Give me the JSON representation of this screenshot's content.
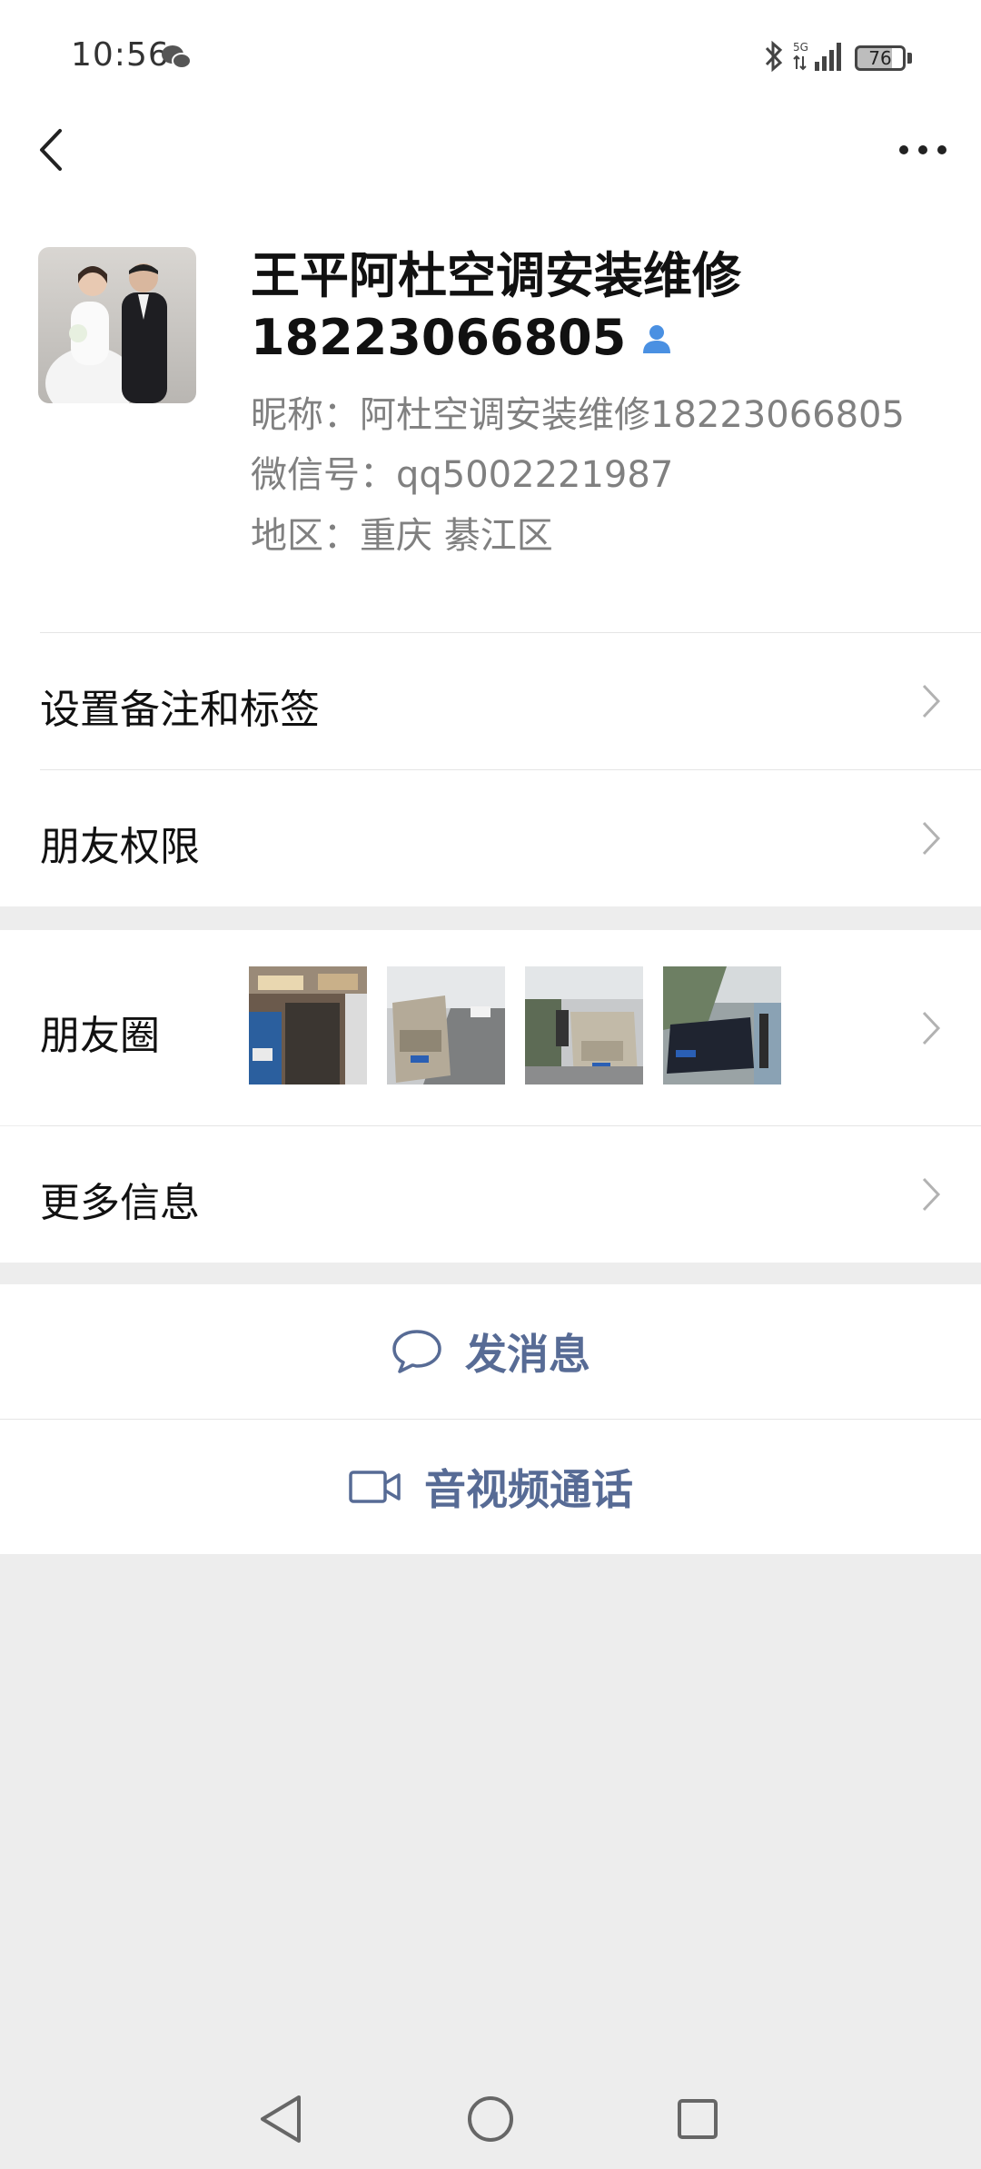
{
  "status_bar": {
    "time": "10:56",
    "network": "5G",
    "battery": "76"
  },
  "profile": {
    "name": "王平阿杜空调安装维修 18223066805",
    "nickname": "昵称：阿杜空调安装维修18223066805",
    "wechat_id": "微信号：qq5002221987",
    "region": "地区：重庆  綦江区"
  },
  "rows": {
    "remark": "设置备注和标签",
    "permissions": "朋友权限",
    "moments": "朋友圈",
    "more_info": "更多信息"
  },
  "actions": {
    "message": "发消息",
    "video_call": "音视频通话"
  },
  "colors": {
    "accent": "#576b95",
    "background": "#ededed",
    "contact_icon": "#4a90e2"
  },
  "icons": {
    "back": "back-icon",
    "more": "more-icon",
    "chat": "chat-bubble-icon",
    "video": "video-camera-icon"
  }
}
